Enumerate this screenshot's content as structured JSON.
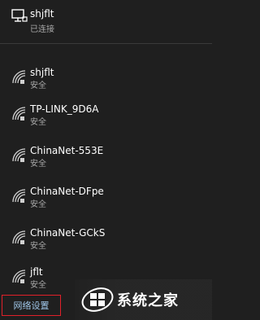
{
  "connected": {
    "name": "shjflt",
    "status": "已连接",
    "icon": "ethernet-icon"
  },
  "networks": [
    {
      "name": "shjflt",
      "status": "安全",
      "icon": "wifi-secure-icon"
    },
    {
      "name": "TP-LINK_9D6A",
      "status": "安全",
      "icon": "wifi-secure-icon"
    },
    {
      "name": "ChinaNet-553E",
      "status": "安全",
      "icon": "wifi-secure-icon"
    },
    {
      "name": "ChinaNet-DFpe",
      "status": "安全",
      "icon": "wifi-secure-icon"
    },
    {
      "name": "ChinaNet-GCkS",
      "status": "安全",
      "icon": "wifi-secure-icon"
    },
    {
      "name": "jflt",
      "status": "安全",
      "icon": "wifi-secure-icon"
    }
  ],
  "footer": {
    "settings_label": "网络设置",
    "highlight_color": "#e0202a"
  },
  "watermark": {
    "text": "系统之家"
  },
  "colors": {
    "background": "#1f1f1f",
    "subtext": "#a8a8a8",
    "link": "#9fc6e8"
  }
}
